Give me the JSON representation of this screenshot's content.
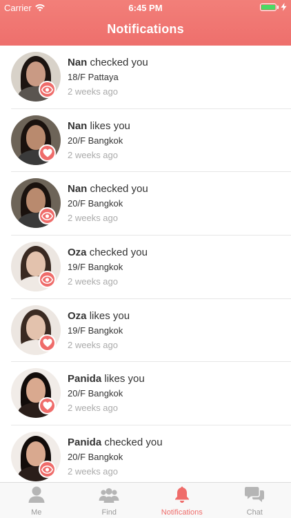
{
  "status_bar": {
    "carrier": "Carrier",
    "time": "6:45 PM"
  },
  "header": {
    "title": "Notifications"
  },
  "colors": {
    "accent": "#ef6c6a",
    "header": "#f27f79",
    "battery": "#4cd964"
  },
  "notifications": [
    {
      "name": "Nan",
      "action": "checked you",
      "info": "18/F Pattaya",
      "time": "2 weeks ago",
      "badge_icon": "eye-icon",
      "skin": "#c99a84",
      "hair": "#1c1411",
      "shirt": "#5a5550",
      "bg": "#d8d2c9"
    },
    {
      "name": "Nan",
      "action": "likes you",
      "info": "20/F Bangkok",
      "time": "2 weeks ago",
      "badge_icon": "heart-icon",
      "skin": "#b98a6e",
      "hair": "#1a120e",
      "shirt": "#3a3a3a",
      "bg": "#6d6458"
    },
    {
      "name": "Nan",
      "action": "checked you",
      "info": "20/F Bangkok",
      "time": "2 weeks ago",
      "badge_icon": "eye-icon",
      "skin": "#b98a6e",
      "hair": "#1a120e",
      "shirt": "#3a3a3a",
      "bg": "#6d6458"
    },
    {
      "name": "Oza",
      "action": "checked you",
      "info": "19/F Bangkok",
      "time": "2 weeks ago",
      "badge_icon": "eye-icon",
      "skin": "#e3c2ad",
      "hair": "#3a2a22",
      "shirt": "#efe9e4",
      "bg": "#ece6e1"
    },
    {
      "name": "Oza",
      "action": "likes you",
      "info": "19/F Bangkok",
      "time": "2 weeks ago",
      "badge_icon": "heart-icon",
      "skin": "#e3c2ad",
      "hair": "#3a2a22",
      "shirt": "#efe9e4",
      "bg": "#ece6e1"
    },
    {
      "name": "Panida",
      "action": "likes you",
      "info": "20/F Bangkok",
      "time": "2 weeks ago",
      "badge_icon": "heart-icon",
      "skin": "#d9a98f",
      "hair": "#120c0a",
      "shirt": "#2a1e1a",
      "bg": "#f1ece8"
    },
    {
      "name": "Panida",
      "action": "checked you",
      "info": "20/F Bangkok",
      "time": "2 weeks ago",
      "badge_icon": "eye-icon",
      "skin": "#d9a98f",
      "hair": "#120c0a",
      "shirt": "#2a1e1a",
      "bg": "#f1ece8"
    }
  ],
  "tabs": [
    {
      "label": "Me",
      "icon": "person-icon",
      "active": false
    },
    {
      "label": "Find",
      "icon": "group-icon",
      "active": false
    },
    {
      "label": "Notifications",
      "icon": "bell-icon",
      "active": true
    },
    {
      "label": "Chat",
      "icon": "chat-bubbles-icon",
      "active": false
    }
  ]
}
